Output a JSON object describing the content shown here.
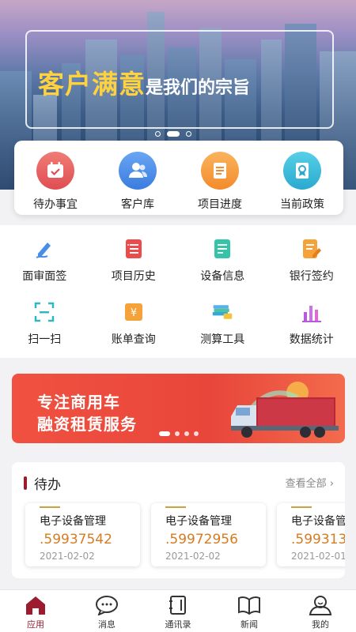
{
  "hero": {
    "slogan_big": "客户满意",
    "slogan_small": "是我们的宗旨"
  },
  "quick": [
    {
      "label": "待办事宜",
      "icon": "calendar-check-icon",
      "color": "#e8585a"
    },
    {
      "label": "客户库",
      "icon": "users-icon",
      "color": "#4a8de9"
    },
    {
      "label": "项目进度",
      "icon": "document-list-icon",
      "color": "#f59a3c"
    },
    {
      "label": "当前政策",
      "icon": "certificate-icon",
      "color": "#36b7d6"
    }
  ],
  "grid": [
    {
      "label": "面审面签",
      "icon": "pen-sign-icon"
    },
    {
      "label": "项目历史",
      "icon": "history-list-icon"
    },
    {
      "label": "设备信息",
      "icon": "device-doc-icon"
    },
    {
      "label": "银行签约",
      "icon": "bank-sign-icon"
    },
    {
      "label": "扫一扫",
      "icon": "scan-icon"
    },
    {
      "label": "账单查询",
      "icon": "bill-query-icon"
    },
    {
      "label": "测算工具",
      "icon": "calculator-books-icon"
    },
    {
      "label": "数据统计",
      "icon": "bar-stats-icon"
    }
  ],
  "promo": {
    "line1": "专注商用车",
    "line2": "融资租赁服务"
  },
  "todo": {
    "title": "待办",
    "more": "查看全部",
    "items": [
      {
        "name": "电子设备管理",
        "number": ".59937542",
        "date": "2021-02-02"
      },
      {
        "name": "电子设备管理",
        "number": ".59972956",
        "date": "2021-02-02"
      },
      {
        "name": "电子设备管理",
        "number": ".599313",
        "date": "2021-02-01"
      }
    ]
  },
  "tabs": [
    {
      "label": "应用",
      "icon": "home-icon",
      "active": true
    },
    {
      "label": "消息",
      "icon": "chat-icon"
    },
    {
      "label": "通讯录",
      "icon": "contacts-book-icon"
    },
    {
      "label": "新闻",
      "icon": "news-book-icon"
    },
    {
      "label": "我的",
      "icon": "profile-icon"
    }
  ]
}
